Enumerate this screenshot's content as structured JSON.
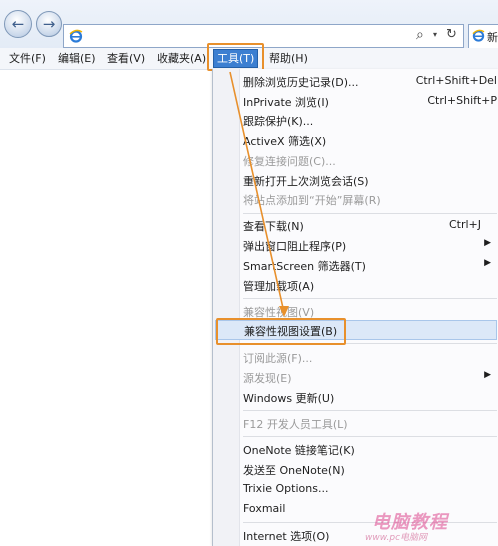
{
  "toolbar": {
    "back_glyph": "←",
    "forward_glyph": "→",
    "address_icon": "ie-icon",
    "search_glyph": "⌕",
    "dropdown_glyph": "▾",
    "refresh_glyph": "↻",
    "tab_label": "新"
  },
  "menubar": {
    "items": [
      "文件(F)",
      "编辑(E)",
      "查看(V)",
      "收藏夹(A)",
      "工具(T)",
      "帮助(H)"
    ],
    "active_index": 4
  },
  "tools_menu": {
    "items": [
      {
        "label": "删除浏览历史记录(D)...",
        "shortcut": "Ctrl+Shift+Del",
        "disabled": false
      },
      {
        "label": "InPrivate 浏览(I)",
        "shortcut": "Ctrl+Shift+P",
        "disabled": false
      },
      {
        "label": "跟踪保护(K)...",
        "shortcut": "",
        "disabled": false
      },
      {
        "label": "ActiveX 筛选(X)",
        "shortcut": "",
        "disabled": false
      },
      {
        "label": "修复连接问题(C)...",
        "shortcut": "",
        "disabled": true
      },
      {
        "label": "重新打开上次浏览会话(S)",
        "shortcut": "",
        "disabled": false
      },
      {
        "label": "将站点添加到“开始”屏幕(R)",
        "shortcut": "",
        "disabled": true
      },
      {
        "label": "查看下载(N)",
        "shortcut": "Ctrl+J",
        "disabled": false
      },
      {
        "label": "弹出窗口阻止程序(P)",
        "shortcut": "",
        "disabled": false,
        "submenu": true
      },
      {
        "label": "SmartScreen 筛选器(T)",
        "shortcut": "",
        "disabled": false,
        "submenu": true
      },
      {
        "label": "管理加载项(A)",
        "shortcut": "",
        "disabled": false
      },
      {
        "label": "兼容性视图(V)",
        "shortcut": "",
        "disabled": true
      },
      {
        "label": "兼容性视图设置(B)",
        "shortcut": "",
        "disabled": false,
        "selected": true
      },
      {
        "label": "订阅此源(F)...",
        "shortcut": "",
        "disabled": true
      },
      {
        "label": "源发现(E)",
        "shortcut": "",
        "disabled": true,
        "submenu": true
      },
      {
        "label": "Windows 更新(U)",
        "shortcut": "",
        "disabled": false
      },
      {
        "label": "F12 开发人员工具(L)",
        "shortcut": "",
        "disabled": true
      },
      {
        "label": "OneNote 链接笔记(K)",
        "shortcut": "",
        "disabled": false
      },
      {
        "label": "发送至 OneNote(N)",
        "shortcut": "",
        "disabled": false
      },
      {
        "label": "Trixie Options...",
        "shortcut": "",
        "disabled": false
      },
      {
        "label": "Foxmail",
        "shortcut": "",
        "disabled": false
      },
      {
        "label": "Internet 选项(O)",
        "shortcut": "",
        "disabled": false
      }
    ],
    "submenu_glyph": "▶"
  },
  "watermark": {
    "main": "电脑教程",
    "sub": "www.pc电脑网"
  },
  "colors": {
    "accent": "#3c7fd1",
    "callout": "#e8902c"
  }
}
